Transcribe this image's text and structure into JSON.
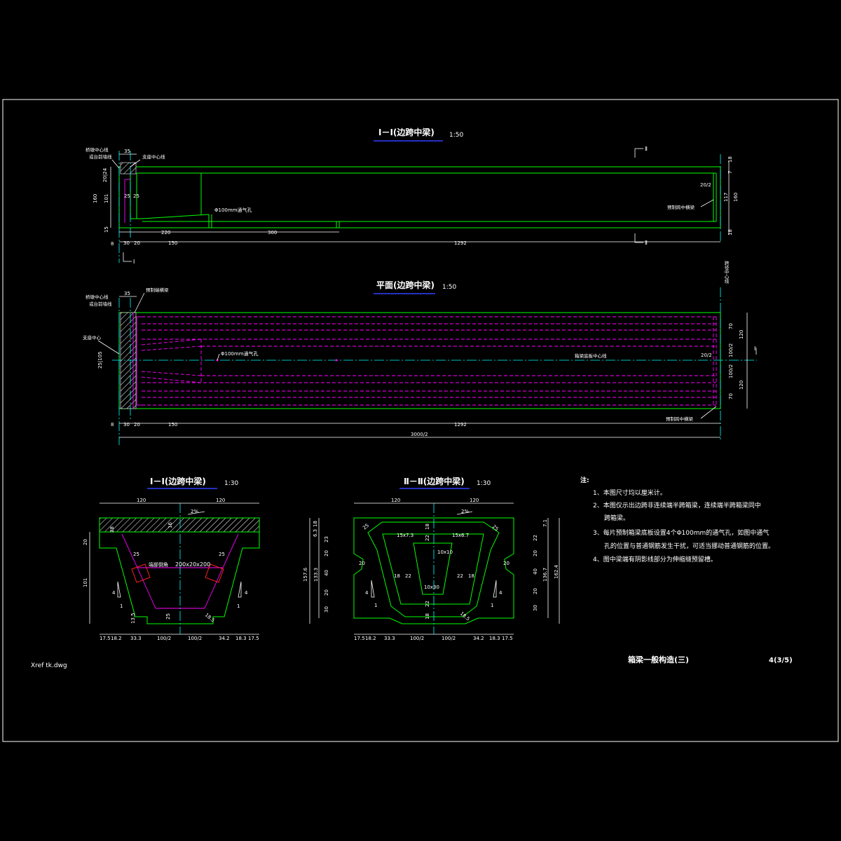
{
  "views": {
    "elevation": {
      "title": "Ⅰ－Ⅰ(边跨中梁)",
      "scale": "1:50"
    },
    "plan": {
      "title": "平面(边跨中梁)",
      "scale": "1:50"
    },
    "section1": {
      "title": "Ⅰ－Ⅰ(边跨中梁)",
      "scale": "1:30"
    },
    "section2": {
      "title": "Ⅱ－Ⅱ(边跨中梁)",
      "scale": "1:30"
    }
  },
  "labels": {
    "pier_centerline": "桥墩中心线",
    "abutment_line": "或台前墙线",
    "bearing_centerline": "支座中心线",
    "bearing_center": "支座中心",
    "vent_hole": "Φ100mm通气孔",
    "precast_span_mid": "预制跨中横梁",
    "precast_end_beam": "预制端横梁",
    "beam_bottom_centerline": "箱梁底板中心线",
    "span_center": "跨径中心线",
    "fillet": "端部倒角",
    "fillet_size": "200x20x200",
    "cut_I": "Ⅰ",
    "cut_II": "Ⅱ"
  },
  "notes": {
    "heading": "注:",
    "items": [
      "1、本图尺寸均以厘米计。",
      "2、本图仅示出边跨非连续端半跨箱梁，连续端半跨箱梁同中",
      "跨箱梁。",
      "3、每片预制箱梁底板设置4个Φ100mm的通气孔，如图中通气",
      "孔的位置与普通钢筋发生干扰，可适当挪动普通钢筋的位置。",
      "4、图中梁端有阴影线部分为伸缩缝预留槽。"
    ]
  },
  "title_block": {
    "name": "箱梁一般构造(三)",
    "sheet": "4(3/5)"
  },
  "xref": "Xref tk.dwg",
  "dims": {
    "e35": "35",
    "e18a": "18",
    "e7": "7",
    "e20_24": "20|24",
    "e25a": "25",
    "e25b": "25",
    "e160": "160",
    "e101": "101",
    "e15": "15",
    "e8": "8",
    "e20_2": "20/2",
    "e117": "117",
    "e160r": "160",
    "e18b": "18",
    "e220": "220",
    "e300": "300",
    "e30": "30",
    "e20": "20",
    "e150": "150",
    "e1292": "1292",
    "p35": "35",
    "p70a": "70",
    "p120a": "120",
    "p100_2a": "100/2",
    "p100_2b": "100/2",
    "p120b": "120",
    "p70b": "70",
    "p25_105": "25|105",
    "p20_2": "20/2",
    "p8": "8",
    "p30": "30",
    "p20": "20",
    "p150": "150",
    "p1292": "1292",
    "p3000_2": "3000/2",
    "s120a": "120",
    "s120b": "120",
    "s2pct": "2%",
    "s20": "20",
    "s101": "101",
    "s16": "16",
    "s25a": "25",
    "s25b": "25",
    "s28": "28",
    "s25c": "25",
    "s13_5": "13.5",
    "s18_5": "18.5",
    "s4a": "4",
    "s1a": "1",
    "s4b": "4",
    "s1b": "1",
    "b17_5a": "17.5",
    "b18_2a": "18.2",
    "b33_3": "33.3",
    "b100_2a": "100/2",
    "b100_2b": "100/2",
    "b34_2": "34.2",
    "b18_3": "18.3",
    "b17_5b": "17.5",
    "t120a": "120",
    "t120b": "120",
    "t2pct": "2%",
    "t25a": "25",
    "t25b": "25",
    "t18a": "18",
    "t22a": "22",
    "t15x7_3": "15x7.3",
    "t15x6_7": "15x6.7",
    "t10x10": "10x10",
    "t20a": "20",
    "t20b": "20",
    "t18b": "18",
    "t22b": "22",
    "t22c": "22",
    "t18c": "18",
    "t10x30": "10x30",
    "t22d": "22",
    "t18d": "18",
    "t4a": "4",
    "t1a": "1",
    "t4b": "4",
    "t1b": "1",
    "t18_5": "18.5",
    "l18": "18",
    "l6_3": "6.3",
    "l23": "23",
    "l20": "20",
    "l40": "40",
    "l20b": "20",
    "l30": "30",
    "l157_6": "157.6",
    "l133_3": "133.3",
    "r7_1": "7.1",
    "r22": "22",
    "r20": "20",
    "r40": "40",
    "r20b": "20",
    "r30": "30",
    "r136_7": "136.7",
    "r162_4": "162.4",
    "c17_5a": "17.5",
    "c18_2a": "18.2",
    "c33_3": "33.3",
    "c100_2a": "100/2",
    "c100_2b": "100/2",
    "c34_2": "34.2",
    "c18_3": "18.3",
    "c17_5b": "17.5"
  }
}
